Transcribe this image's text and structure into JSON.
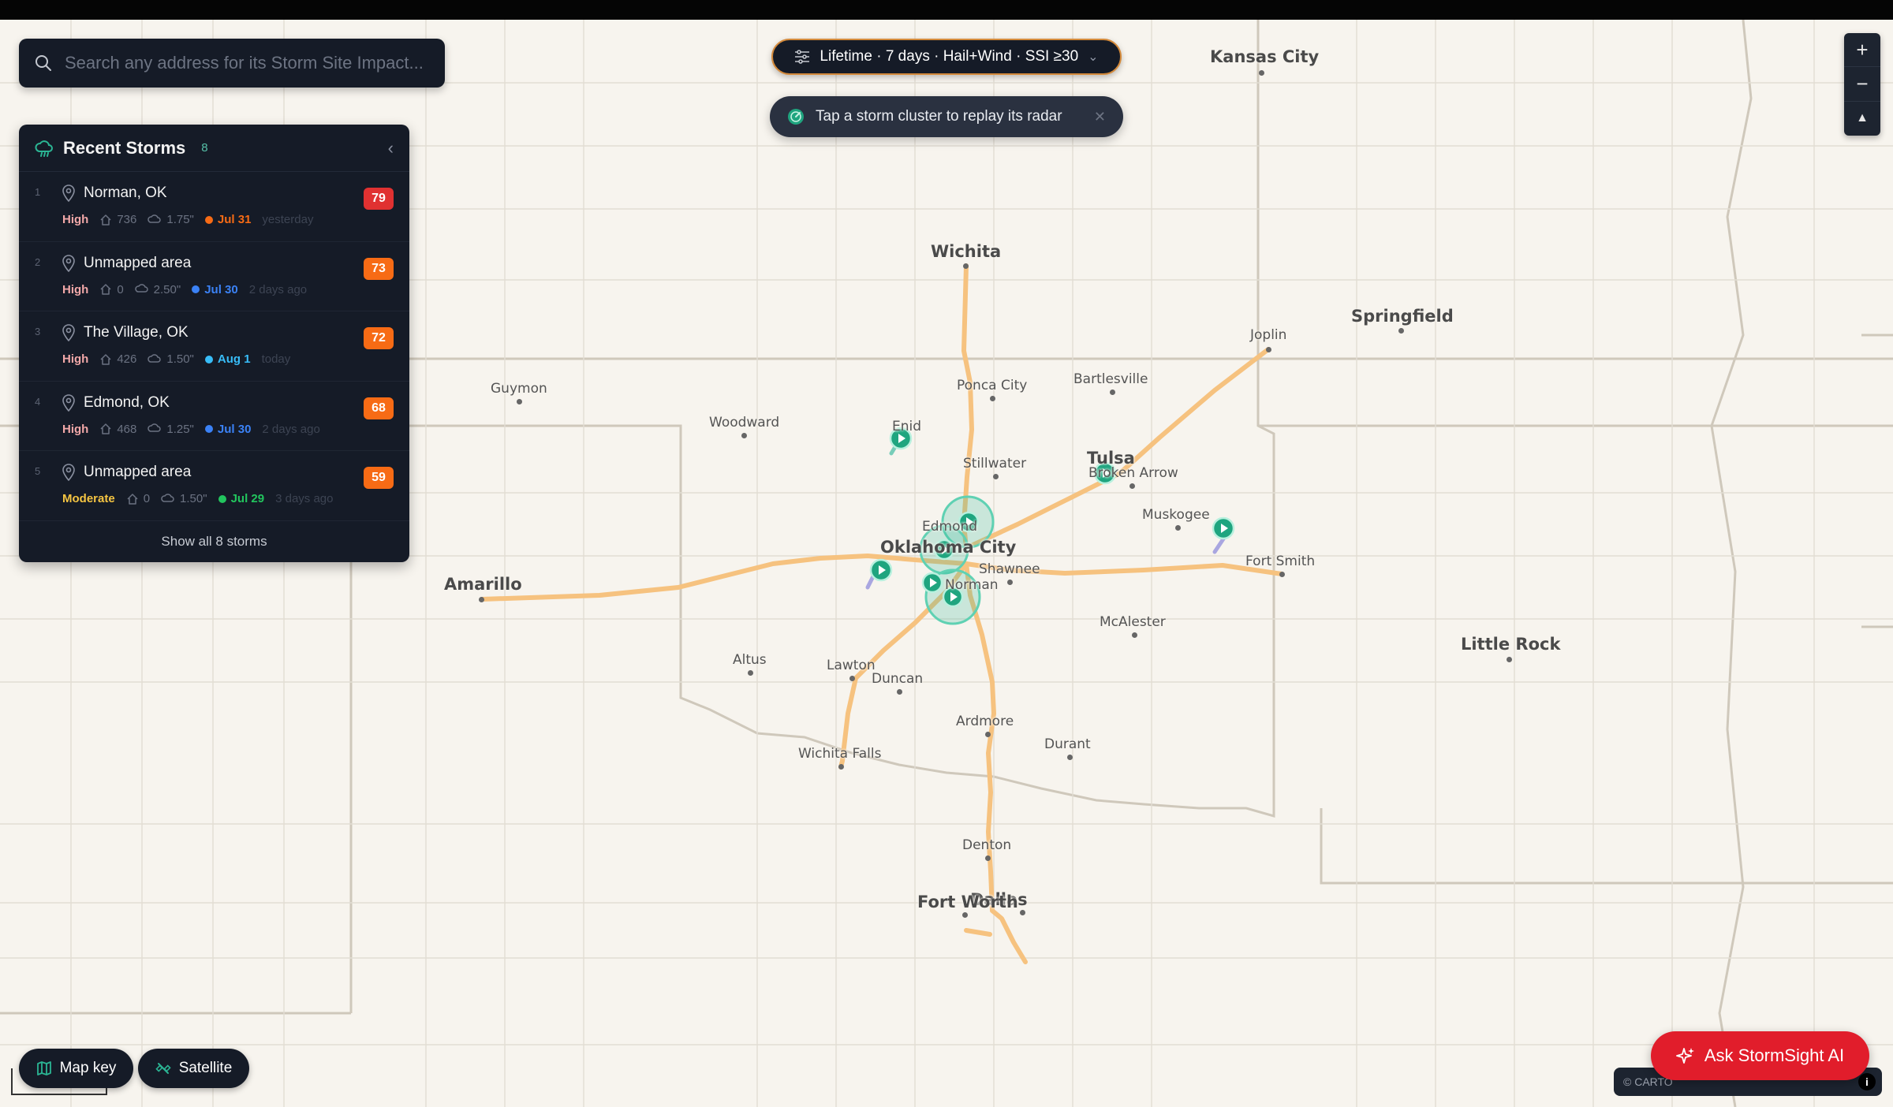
{
  "search": {
    "placeholder": "Search any address for its Storm Site Impact..."
  },
  "filter": {
    "label": "Lifetime · 7 days · Hail+Wind · SSI ≥30"
  },
  "hint": {
    "text": "Tap a storm cluster to replay its radar"
  },
  "recent": {
    "title": "Recent Storms",
    "count": "8",
    "show_all": "Show all 8 storms",
    "items": [
      {
        "index": "1",
        "name": "Norman, OK",
        "score": "79",
        "score_color": "#e03131",
        "severity": "High",
        "severity_color": "#f2a8a8",
        "homes": "736",
        "hail": "1.75\"",
        "date": "Jul 31",
        "date_color": "#f76b15",
        "ago": "yesterday"
      },
      {
        "index": "2",
        "name": "Unmapped area",
        "score": "73",
        "score_color": "#f76b15",
        "severity": "High",
        "severity_color": "#f2a8a8",
        "homes": "0",
        "hail": "2.50\"",
        "date": "Jul 30",
        "date_color": "#3b82f6",
        "ago": "2 days ago"
      },
      {
        "index": "3",
        "name": "The Village, OK",
        "score": "72",
        "score_color": "#f76b15",
        "severity": "High",
        "severity_color": "#f2a8a8",
        "homes": "426",
        "hail": "1.50\"",
        "date": "Aug 1",
        "date_color": "#38bdf8",
        "ago": "today"
      },
      {
        "index": "4",
        "name": "Edmond, OK",
        "score": "68",
        "score_color": "#f76b15",
        "severity": "High",
        "severity_color": "#f2a8a8",
        "homes": "468",
        "hail": "1.25\"",
        "date": "Jul 30",
        "date_color": "#3b82f6",
        "ago": "2 days ago"
      },
      {
        "index": "5",
        "name": "Unmapped area",
        "score": "59",
        "score_color": "#f76b15",
        "severity": "Moderate",
        "severity_color": "#f5c542",
        "homes": "0",
        "hail": "1.50\"",
        "date": "Jul 29",
        "date_color": "#22c55e",
        "ago": "3 days ago"
      }
    ]
  },
  "zoom": {
    "in": "+",
    "out": "−",
    "north": "▲"
  },
  "map_key": {
    "label": "Map key"
  },
  "satellite": {
    "label": "Satellite"
  },
  "ask_ai": {
    "label": "Ask StormSight AI"
  },
  "attribution": {
    "text": "© CARTO",
    "info": "i"
  },
  "cities": [
    {
      "name": "Kansas City",
      "big": true
    },
    {
      "name": "Wichita",
      "big": true
    },
    {
      "name": "Springfield",
      "big": true
    },
    {
      "name": "Joplin",
      "big": false
    },
    {
      "name": "Guymon",
      "big": false
    },
    {
      "name": "Woodward",
      "big": false
    },
    {
      "name": "Ponca City",
      "big": false
    },
    {
      "name": "Bartlesville",
      "big": false
    },
    {
      "name": "Enid",
      "big": false
    },
    {
      "name": "Stillwater",
      "big": false
    },
    {
      "name": "Tulsa",
      "big": true
    },
    {
      "name": "Broken Arrow",
      "big": false
    },
    {
      "name": "Muskogee",
      "big": false
    },
    {
      "name": "Edmond",
      "big": false
    },
    {
      "name": "Oklahoma City",
      "big": true
    },
    {
      "name": "Shawnee",
      "big": false
    },
    {
      "name": "Fort Smith",
      "big": false
    },
    {
      "name": "Amarillo",
      "big": true
    },
    {
      "name": "Norman",
      "big": false
    },
    {
      "name": "McAlester",
      "big": false
    },
    {
      "name": "Little Rock",
      "big": true
    },
    {
      "name": "Altus",
      "big": false
    },
    {
      "name": "Lawton",
      "big": false
    },
    {
      "name": "Duncan",
      "big": false
    },
    {
      "name": "Ardmore",
      "big": false
    },
    {
      "name": "Durant",
      "big": false
    },
    {
      "name": "Wichita Falls",
      "big": false
    },
    {
      "name": "Denton",
      "big": false
    },
    {
      "name": "Fort Worth",
      "big": true
    },
    {
      "name": "Dallas",
      "big": true
    }
  ],
  "colors": {
    "panel_bg": "#151b27",
    "accent_teal": "#2bb594",
    "highway": "#f6c27f",
    "alert_red": "#e11d2b"
  }
}
